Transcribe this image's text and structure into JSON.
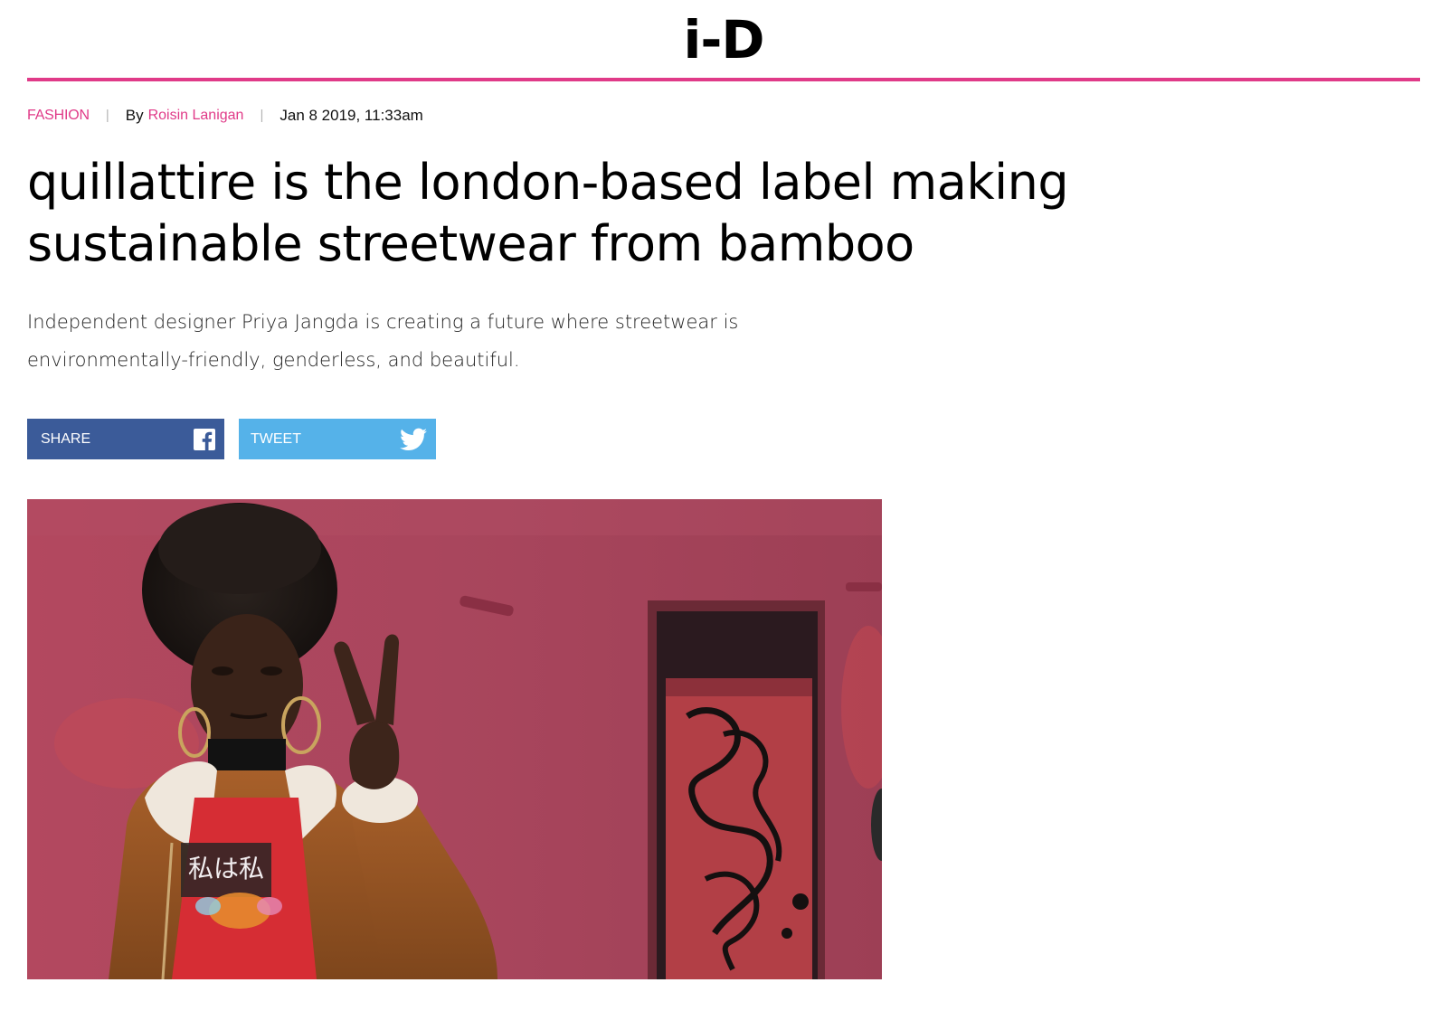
{
  "site": {
    "logo": "i-D",
    "brand_color": "#e03a88"
  },
  "article": {
    "category": "FASHION",
    "byline_prefix": "By",
    "author": "Roisin Lanigan",
    "date": "Jan 8 2019, 11:33am",
    "headline": "quillattire is the london-based label making sustainable streetwear from bamboo",
    "dek": "Independent designer Priya Jangda is creating a future where streetwear is environmentally-friendly, genderless, and beautiful."
  },
  "share": {
    "facebook_label": "SHARE",
    "facebook_icon": "facebook-icon",
    "facebook_color": "#3b5b99",
    "twitter_label": "TWEET",
    "twitter_icon": "twitter-bird-icon",
    "twitter_color": "#55b2e9"
  },
  "hero": {
    "tshirt_text": "私は私"
  }
}
